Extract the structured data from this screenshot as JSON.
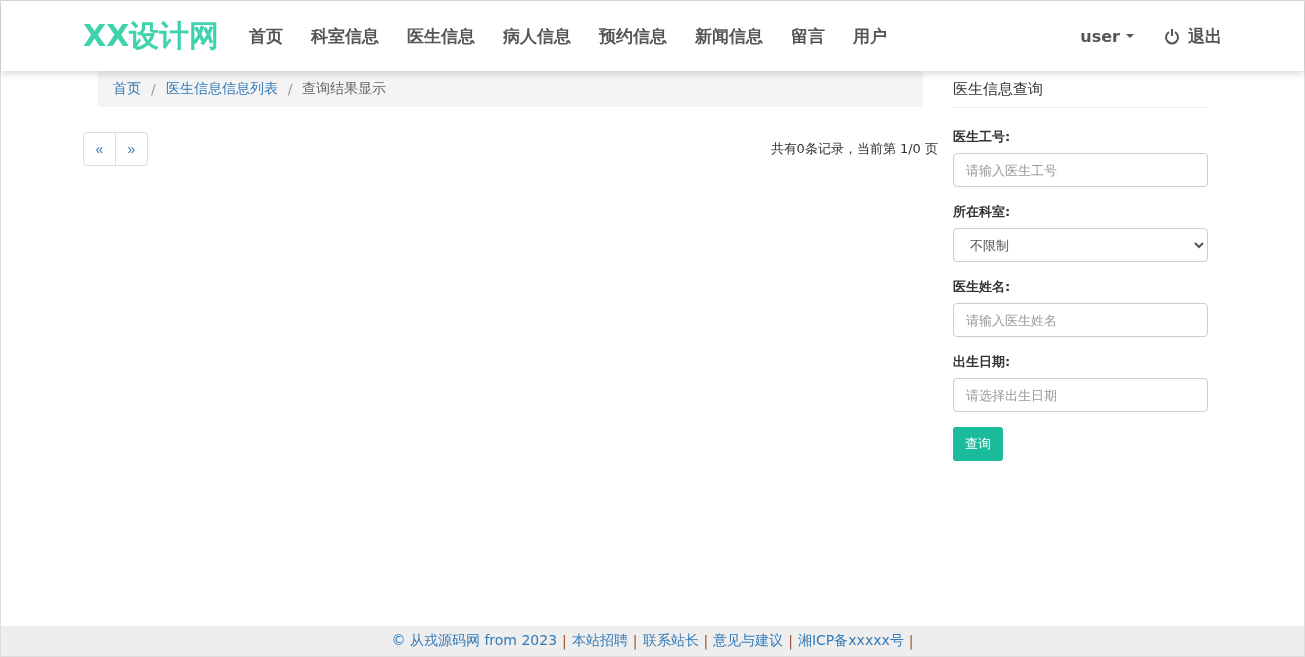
{
  "navbar": {
    "brand": "XX设计网",
    "items": [
      "首页",
      "科室信息",
      "医生信息",
      "病人信息",
      "预约信息",
      "新闻信息",
      "留言",
      "用户"
    ],
    "user_menu": "user",
    "logout": "退出"
  },
  "breadcrumb_divider": "/",
  "breadcrumb": [
    {
      "label": "首页",
      "link": true
    },
    {
      "label": "医生信息信息列表",
      "link": true
    },
    {
      "label": "查询结果显示",
      "link": false
    }
  ],
  "pagination": {
    "buttons": [
      "«",
      "»"
    ],
    "summary": "共有0条记录，当前第 1/0 页"
  },
  "search_panel": {
    "title": "医生信息查询",
    "fields": [
      {
        "kind": "input",
        "label": "医生工号:",
        "placeholder": "请输入医生工号"
      },
      {
        "kind": "select",
        "label": "所在科室:",
        "value": "不限制"
      },
      {
        "kind": "input",
        "label": "医生姓名:",
        "placeholder": "请输入医生姓名"
      },
      {
        "kind": "input",
        "label": "出生日期:",
        "placeholder": "请选择出生日期"
      }
    ],
    "button": "查询"
  },
  "footer": {
    "separator": "|",
    "links": [
      "© 从戎源码网 from 2023",
      "本站招聘",
      "联系站长",
      "意见与建议",
      "湘ICP备xxxxx号"
    ]
  }
}
